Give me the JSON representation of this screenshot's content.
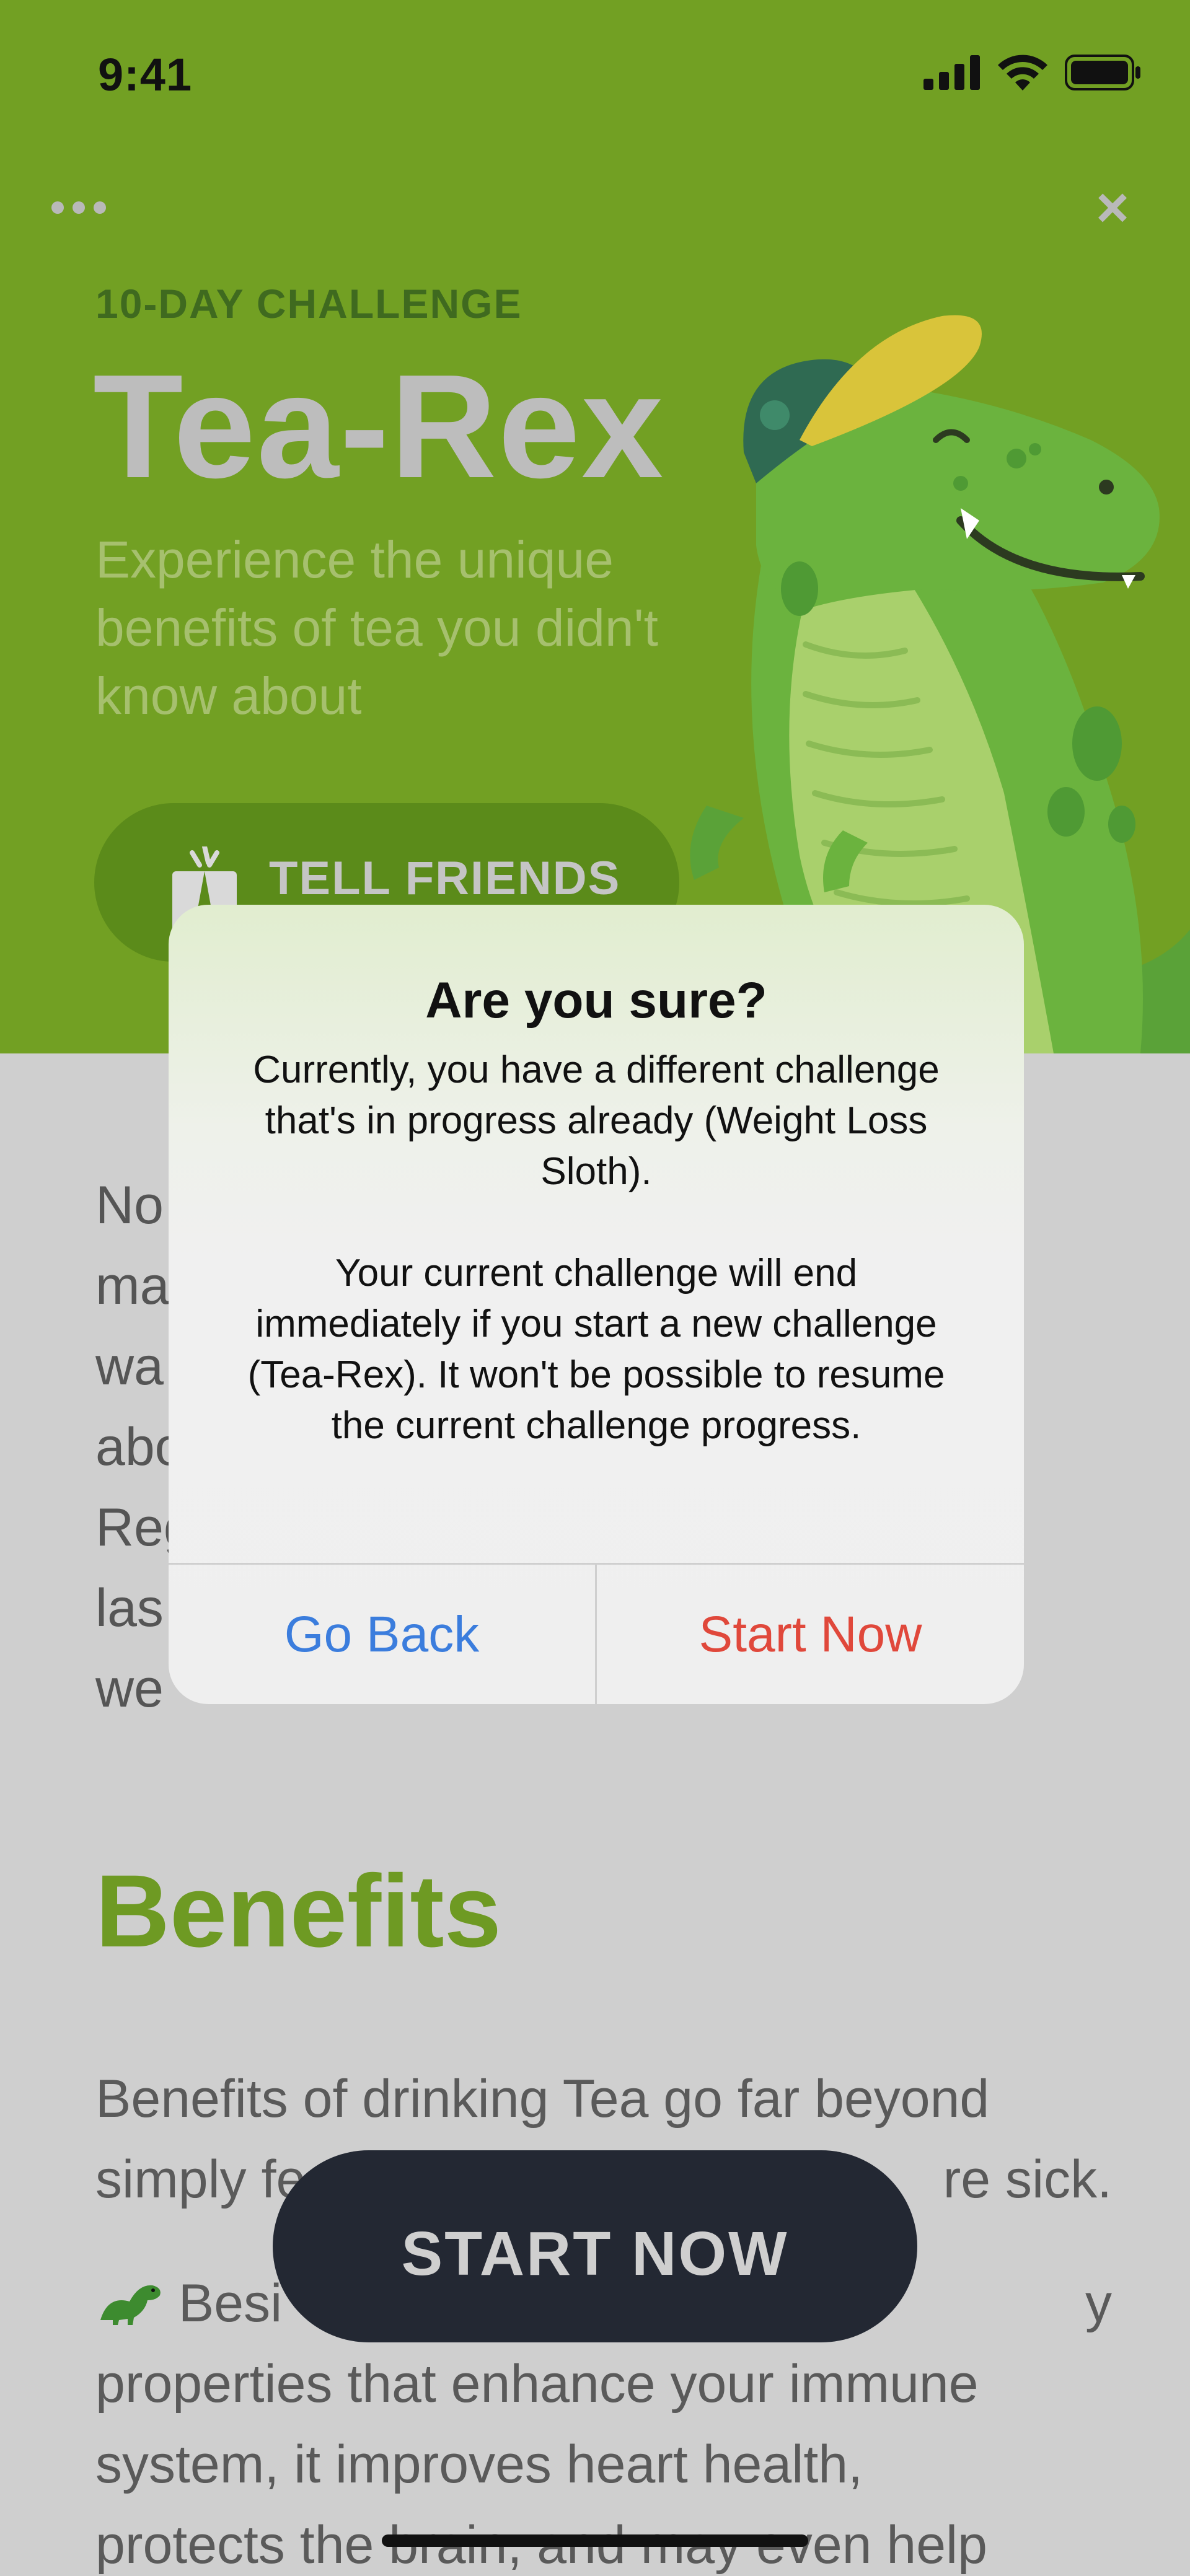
{
  "status_bar": {
    "time": "9:41"
  },
  "hero": {
    "kicker": "10-DAY CHALLENGE",
    "title": "Tea-Rex",
    "subtitle": "Experience the unique benefits of tea you didn't know about",
    "tell_friends_label": "TELL FRIENDS",
    "menu_icon": "more-horizontal-icon",
    "close_icon": "close-icon"
  },
  "body": {
    "paragraph_fragments": [
      "No",
      "ma",
      "wa",
      "abo",
      "Reg",
      "las",
      "we"
    ],
    "benefits_heading": "Benefits",
    "benefit_line1_left": "Benefits of drinking Tea go far beyond",
    "benefit_line2_left": "simply fe",
    "benefit_line2_right": "re sick.",
    "benefit_line3_left": "Besi",
    "benefit_line3_right": "y",
    "benefit_line4": "properties that enhance your immune",
    "benefit_line5": "system, it improves heart health,",
    "benefit_line6": "protects the brain, and may even help"
  },
  "cta": {
    "label": "START NOW"
  },
  "modal": {
    "title": "Are you sure?",
    "message_p1": "Currently, you have a different challenge that's in progress already (Weight Loss Sloth).",
    "message_p2": "Your current challenge will end immediately if you start a new challenge (Tea-Rex). It won't be possible to resume the current challenge progress.",
    "go_back_label": "Go Back",
    "start_now_label": "Start Now"
  },
  "colors": {
    "hero_bg": "#72a023",
    "accent_green": "#6e9a23",
    "cta_bg": "#232833",
    "go_back": "#3b7ddd",
    "start_now": "#e0483b"
  }
}
